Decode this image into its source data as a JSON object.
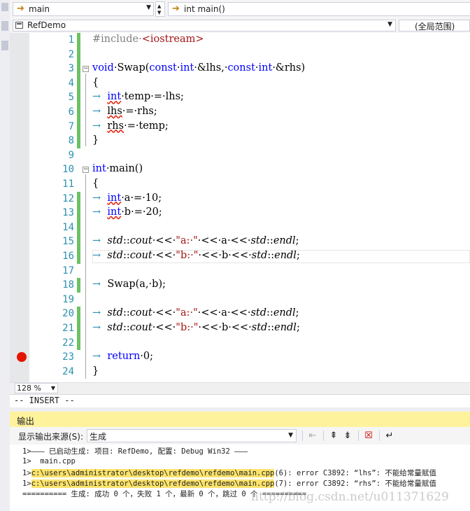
{
  "nav": {
    "left_combo": "main",
    "right_combo": "int main()"
  },
  "file_bar": {
    "file_combo": "RefDemo",
    "scope_combo": "(全局范围)"
  },
  "editor": {
    "lines": [
      {
        "num": "1"
      },
      {
        "num": "2"
      },
      {
        "num": "3"
      },
      {
        "num": "4"
      },
      {
        "num": "5"
      },
      {
        "num": "6"
      },
      {
        "num": "7"
      },
      {
        "num": "8"
      },
      {
        "num": "9"
      },
      {
        "num": "10"
      },
      {
        "num": "11"
      },
      {
        "num": "12"
      },
      {
        "num": "13"
      },
      {
        "num": "14"
      },
      {
        "num": "15"
      },
      {
        "num": "16"
      },
      {
        "num": "17"
      },
      {
        "num": "18"
      },
      {
        "num": "19"
      },
      {
        "num": "20"
      },
      {
        "num": "21"
      },
      {
        "num": "22"
      },
      {
        "num": "23"
      },
      {
        "num": "24"
      }
    ],
    "code": {
      "l1_pp": "#include·",
      "l1_inc": "<iostream>",
      "l3_void": "void",
      "l3_rest": "·Swap(",
      "l3_const1": "const",
      "l3_int1": "int",
      "l3_p1": "·&lhs,·",
      "l3_const2": "const",
      "l3_int2": "int",
      "l3_p2": "·&rhs)",
      "brace_open": "{",
      "brace_close": "}",
      "l5_int": "int",
      "l5_rest": "·temp·=·lhs;",
      "l6_var": "lhs",
      "l6_rest": "·=·rhs;",
      "l7_var": "rhs",
      "l7_rest": "·=·temp;",
      "l10_int": "int",
      "l10_rest": "·main()",
      "l12_int": "int",
      "l12_rest": "·a·=·10;",
      "l13_int": "int",
      "l13_rest": "·b·=·20;",
      "std": "std",
      "cout": "cout",
      "endl": "endl",
      "str_a": "\"a:·\"",
      "str_b": "\"b:·\"",
      "var_a": "a",
      "var_b": "b",
      "l18": "Swap(a,·b);",
      "l23_ret": "return",
      "l23_rest": "·0;"
    }
  },
  "zoom": "128 %",
  "mode": "-- INSERT --",
  "output": {
    "header": "输出",
    "source_label": "显示输出来源(S):",
    "source_value": "生成",
    "lines": {
      "l1": "1>——— 已启动生成: 项目: RefDemo, 配置: Debug Win32 ———",
      "l2": "1>  main.cpp",
      "l3_prefix": "1>",
      "l3_path": "c:\\users\\administrator\\desktop\\refdemo\\refdemo\\main.cpp",
      "l3_msg": "(6): error C3892: “lhs”: 不能给常量赋值",
      "l4_prefix": "1>",
      "l4_path": "c:\\users\\administrator\\desktop\\refdemo\\refdemo\\main.cpp",
      "l4_msg": "(7): error C3892: “rhs”: 不能给常量赋值",
      "l5": "========== 生成: 成功 0 个，失败 1 个，最新 0 个，跳过 0 个 =========="
    },
    "watermark": "http://blog.csdn.net/u011371629"
  },
  "colors": {
    "keyword": "#0000ff",
    "string": "#a31515",
    "line_number": "#2b91af",
    "change_saved": "#6cc164",
    "breakpoint": "#e51400",
    "output_header": "#fff29d",
    "path_highlight": "#fbe36c"
  },
  "icons": [
    "arrow-icon",
    "breakpoint-icon",
    "clear-icon",
    "word-wrap-icon",
    "prev-message-icon",
    "next-message-icon",
    "find-icon"
  ]
}
